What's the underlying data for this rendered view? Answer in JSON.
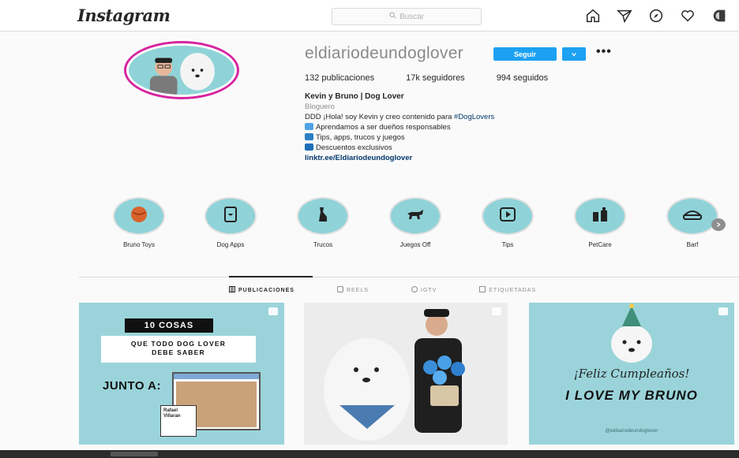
{
  "header": {
    "logo": "Instagram",
    "search_placeholder": "Buscar"
  },
  "profile": {
    "username": "eldiariodeundoglover",
    "follow_label": "Seguir",
    "options_label": "•••",
    "stats": {
      "posts": "132 publicaciones",
      "followers": "17k seguidores",
      "following": "994 seguidos"
    },
    "bio": {
      "name": "Kevin y Bruno | Dog Lover",
      "category": "Bloguero",
      "line1_prefix": "DDD ¡Hola! soy Kevin y creo contenido para ",
      "line1_tag": "#DogLovers",
      "line2": "Aprendamos a ser dueños responsables",
      "line3": "Tips, apps, trucos y juegos",
      "line4": "Descuentos exclusivos",
      "link": "linktr.ee/Eldiariodeundoglover"
    }
  },
  "highlights": [
    {
      "label": "Bruno Toys"
    },
    {
      "label": "Dog Apps"
    },
    {
      "label": "Trucos"
    },
    {
      "label": "Juegos Off"
    },
    {
      "label": "Tips"
    },
    {
      "label": "PetCare"
    },
    {
      "label": "Barf"
    }
  ],
  "tabs": [
    {
      "label": "PUBLICACIONES"
    },
    {
      "label": "REELS"
    },
    {
      "label": "IGTV"
    },
    {
      "label": "ETIQUETADAS"
    }
  ],
  "posts": {
    "p1": {
      "banner": "10 COSAS",
      "subtitle_1": "QUE TODO DOG LOVER",
      "subtitle_2": "DEBE SABER",
      "junto": "JUNTO A:",
      "card_1": "Rafael",
      "card_2": "Villaran"
    },
    "p3": {
      "feliz": "¡Feliz Cumpleaños!",
      "love": "I LOVE MY BRUNO",
      "handle": "@eldiariodeundoglover"
    }
  },
  "colors": {
    "accent_blue": "#1da1f2",
    "highlight_teal": "#8fd3d8",
    "story_ring": "#d6249f"
  }
}
